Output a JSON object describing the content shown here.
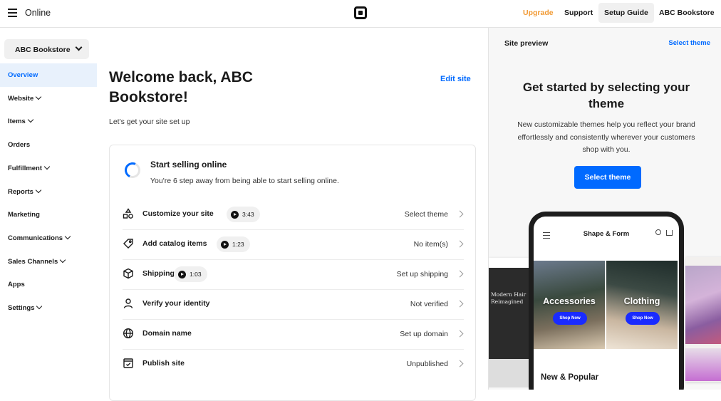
{
  "topbar": {
    "app_name": "Online",
    "upgrade": "Upgrade",
    "support": "Support",
    "setup_guide": "Setup Guide",
    "account": "ABC Bookstore"
  },
  "sidebar": {
    "store_selector": "ABC Bookstore",
    "items": [
      {
        "label": "Overview",
        "active": true,
        "expandable": false
      },
      {
        "label": "Website",
        "expandable": true
      },
      {
        "label": "Items",
        "expandable": true
      },
      {
        "label": "Orders",
        "expandable": false
      },
      {
        "label": "Fulfillment",
        "expandable": true
      },
      {
        "label": "Reports",
        "expandable": true
      },
      {
        "label": "Marketing",
        "expandable": false
      },
      {
        "label": "Communications",
        "expandable": true
      },
      {
        "label": "Sales Channels",
        "expandable": true
      },
      {
        "label": "Apps",
        "expandable": false
      },
      {
        "label": "Settings",
        "expandable": true
      }
    ]
  },
  "main": {
    "title": "Welcome back, ABC Bookstore!",
    "edit_site": "Edit site",
    "subtitle": "Let's get your site set up",
    "card": {
      "title": "Start selling online",
      "description": "You're 6 step away from being able to start selling online.",
      "tasks": [
        {
          "label": "Customize your site",
          "icon": "shapes-icon",
          "video": "3:43",
          "status": "Select theme"
        },
        {
          "label": "Add catalog items",
          "icon": "tag-icon",
          "video": "1:23",
          "status": "No item(s)"
        },
        {
          "label": "Shipping",
          "icon": "box-icon",
          "video": "1:03",
          "status": "Set up shipping"
        },
        {
          "label": "Verify your identity",
          "icon": "person-icon",
          "status": "Not verified"
        },
        {
          "label": "Domain name",
          "icon": "globe-icon",
          "status": "Set up domain"
        },
        {
          "label": "Publish site",
          "icon": "publish-icon",
          "status": "Unpublished"
        }
      ]
    }
  },
  "preview": {
    "title": "Site preview",
    "select_theme_link": "Select theme",
    "heading": "Get started by selecting your theme",
    "description": "New customizable themes help you reflect your brand effortlessly and consistently wherever your customers shop with you.",
    "select_theme_button": "Select theme",
    "left_theme_text": "Modern Hair Reimagined",
    "phone": {
      "store_name": "Shape & Form",
      "tile_1": "Accessories",
      "tile_2": "Clothing",
      "shop_now": "Shop Now",
      "section": "New & Popular"
    }
  },
  "colors": {
    "accent": "#006aff",
    "upgrade": "#f19a34",
    "active_bg": "#e8f1fc"
  }
}
